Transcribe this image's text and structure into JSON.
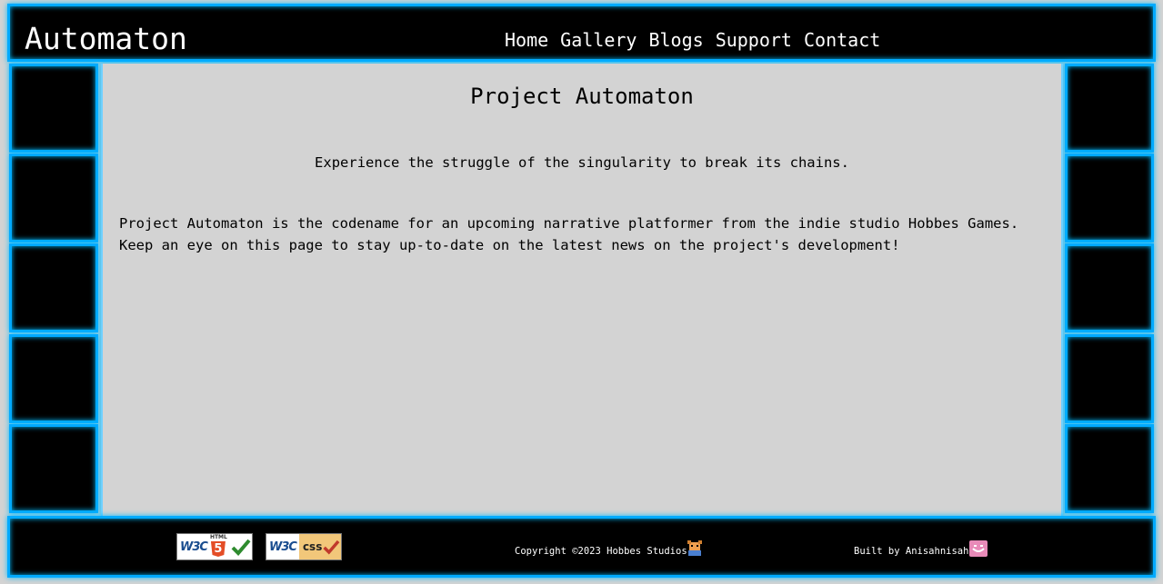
{
  "site": {
    "title": "Automaton"
  },
  "nav": {
    "items": [
      "Home",
      "Gallery",
      "Blogs",
      "Support",
      "Contact"
    ]
  },
  "main": {
    "heading": "Project Automaton",
    "tagline": "Experience the struggle of the singularity to break its chains.",
    "description": "Project Automaton is the codename for an upcoming narrative platformer from the indie studio Hobbes Games. Keep an eye on this page to stay up-to-date on the latest news on the project's development!"
  },
  "footer": {
    "badges": {
      "html": {
        "w3c": "W3C",
        "label": "HTML",
        "number": "5"
      },
      "css": {
        "w3c": "W3C",
        "label": "css"
      }
    },
    "copyright": "Copyright ©2023 Hobbes Studios",
    "credit": "Built by Anisahnisah"
  },
  "colors": {
    "neon": "#00aaff",
    "panel": "#000000",
    "content_bg": "#d3d3d3"
  }
}
